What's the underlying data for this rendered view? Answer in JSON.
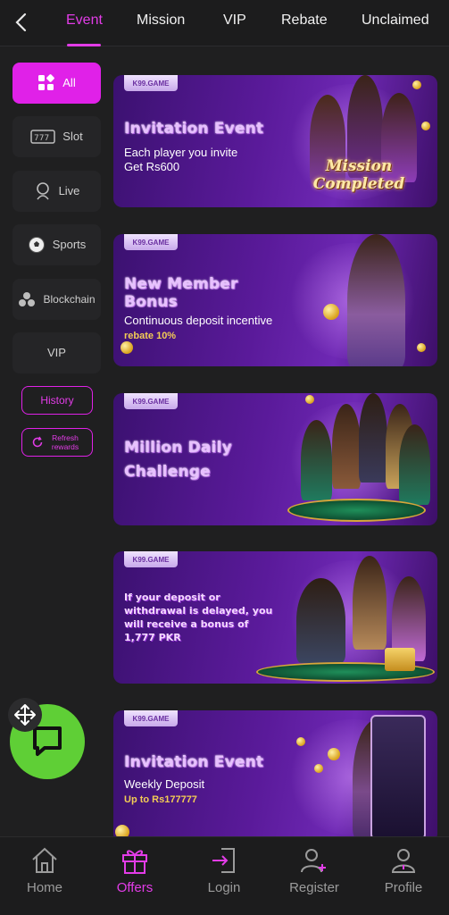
{
  "tabs": [
    {
      "label": "Event",
      "active": true
    },
    {
      "label": "Mission"
    },
    {
      "label": "VIP"
    },
    {
      "label": "Rebate"
    },
    {
      "label": "Unclaimed"
    }
  ],
  "sidebar": {
    "items": [
      {
        "label": "All",
        "icon": "grid-icon",
        "active": true
      },
      {
        "label": "Slot",
        "icon": "slot-icon"
      },
      {
        "label": "Live",
        "icon": "live-icon"
      },
      {
        "label": "Sports",
        "icon": "soccer-ball-icon"
      },
      {
        "label": "Blockchain",
        "icon": "blockchain-icon"
      },
      {
        "label": "VIP"
      }
    ],
    "history_label": "History",
    "refresh_label": "Refresh rewards"
  },
  "banners": [
    {
      "badge": "K99.GAME",
      "title": "Invitation Event",
      "line1": "Each player you invite",
      "line2": "Get Rs600",
      "overlay": "Mission Completed"
    },
    {
      "badge": "K99.GAME",
      "title": "New Member Bonus",
      "line1": "Continuous deposit incentive",
      "gold": "rebate 10%"
    },
    {
      "badge": "K99.GAME",
      "title": "Million Daily Challenge"
    },
    {
      "badge": "K99.GAME",
      "text": "If your deposit or withdrawal is delayed, you will receive a bonus of 1,777 PKR"
    },
    {
      "badge": "K99.GAME",
      "title": "Invitation Event",
      "line1": "Weekly Deposit",
      "gold": "Up to Rs177777"
    }
  ],
  "bottom_nav": [
    {
      "label": "Home",
      "icon": "home-icon"
    },
    {
      "label": "Offers",
      "icon": "gift-icon",
      "active": true
    },
    {
      "label": "Login",
      "icon": "login-icon"
    },
    {
      "label": "Register",
      "icon": "register-icon"
    },
    {
      "label": "Profile",
      "icon": "profile-icon"
    }
  ],
  "colors": {
    "accent": "#e021e8",
    "chat_button": "#5fcf36",
    "background": "#1f1f20"
  }
}
